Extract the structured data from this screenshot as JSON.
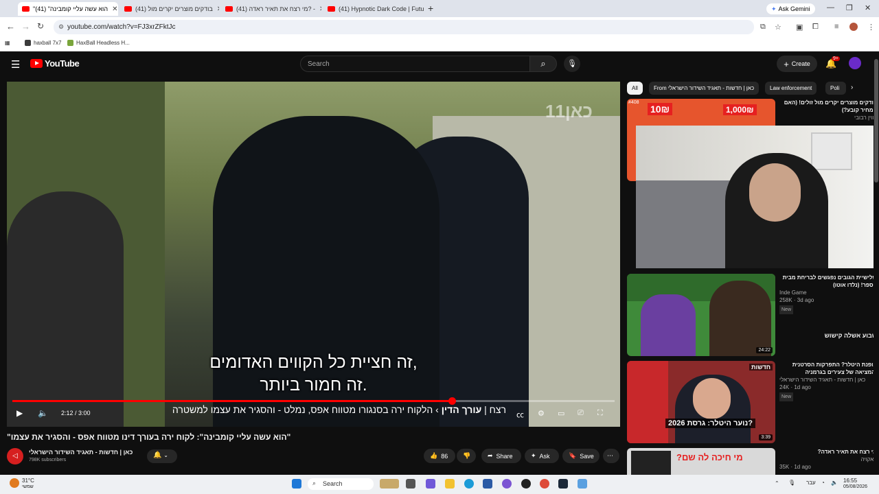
{
  "browser": {
    "tabs": [
      {
        "label": "\"הוא עשה עליי קומבינה\" (41)"
      },
      {
        "label": "(41) בודקים מוצרים יקרים מול"
      },
      {
        "label": "(41) מי רצח את תאיר ראדה? -"
      },
      {
        "label": "(41) Hypnotic Dark Code | Futu"
      }
    ],
    "ask_gemini": "Ask Gemini",
    "url": "youtube.com/watch?v=FJ3xrZFktJc",
    "bookmarks": [
      {
        "label": "haxball 7x7",
        "color": "#3b3b3b"
      },
      {
        "label": "HaxBall Headless H...",
        "color": "#7aa53b"
      }
    ]
  },
  "youtube": {
    "logo": "YouTube",
    "search_placeholder": "Search",
    "create_label": "Create",
    "notification_badge": "9+",
    "colors": {
      "accent": "#ff0000",
      "bg": "#0f0f0f"
    }
  },
  "player": {
    "watermark": "כאן11",
    "subtitles": [
      "זה חציית כל הקווים האדומים,",
      "זה חמור ביותר."
    ],
    "time": "2:12 / 3:00",
    "progress": 0.73,
    "chapter_prefix": "הלקוח ירה בסנגורו מטווח אפס, נמלט - והסגיר את עצמו למשטרה",
    "chapter_bold": "עורך הדין",
    "chapter_tail": "רצח",
    "channel_logo_text": "כאן חדשות"
  },
  "video": {
    "title": "\"הוא עשה עליי קומבינה\": לקוח ירה בעורך דינו מטווח אפס - והסגיר את עצמו\"",
    "channel": "כאן | חדשות - תאגיד השידור הישראלי",
    "subscribers": "798K subscribers",
    "likes": "86",
    "share": "Share",
    "ask": "Ask",
    "save": "Save"
  },
  "chips": [
    {
      "label": "All"
    },
    {
      "label": "From כאן | חדשות - תאגיד השידור הישראלי"
    },
    {
      "label": "Law enforcement"
    },
    {
      "label": "Poli"
    }
  ],
  "recommendations": [
    {
      "title": "בודקים מוצרים יקרים מול זולים! (האם המחיר קובע?)",
      "channel": "קווין רבובי",
      "meta": "",
      "badge": "",
      "duration": "",
      "thumb_tag": "#408",
      "thumb_text_a": "10₪",
      "thumb_text_b": "1,000₪",
      "thumb_color": "#e6552d"
    },
    {
      "title": "שלישיית הגובים נפגשים לבריחת מבית הספר! (נלדו אוטו)",
      "channel": "Inde Game",
      "meta": "258K · 3d ago",
      "badge": "New",
      "duration": "24:22",
      "thumb_caption": "שבוע אשלה קישוש",
      "thumb_color": "#3f8a3a"
    },
    {
      "title": "אופנת היטלר? התפרקות הסרטנית והמציאה של צעירים בגרמניה",
      "channel": "כאן | חדשות - תאגיד השידור הישראלי",
      "meta": "24K · 1d ago",
      "badge": "New",
      "duration": "3:39",
      "thumb_caption": "נוער היטלר: גרסת 2026?",
      "thumb_tag": "חדשות",
      "thumb_color": "#8a2a2a"
    },
    {
      "title": "מי רצח את תאיר ראדה?",
      "channel": "באקויה",
      "meta": "35K · 1d ago",
      "badge": "",
      "duration": "",
      "thumb_caption": "מי חיכה לה שם?",
      "thumb_color": "#d9d9d9"
    }
  ],
  "taskbar": {
    "weather_temp": "31°C",
    "weather_desc": "שמשי",
    "search": "Search",
    "time": "16:55",
    "date": "05/08/2026"
  }
}
